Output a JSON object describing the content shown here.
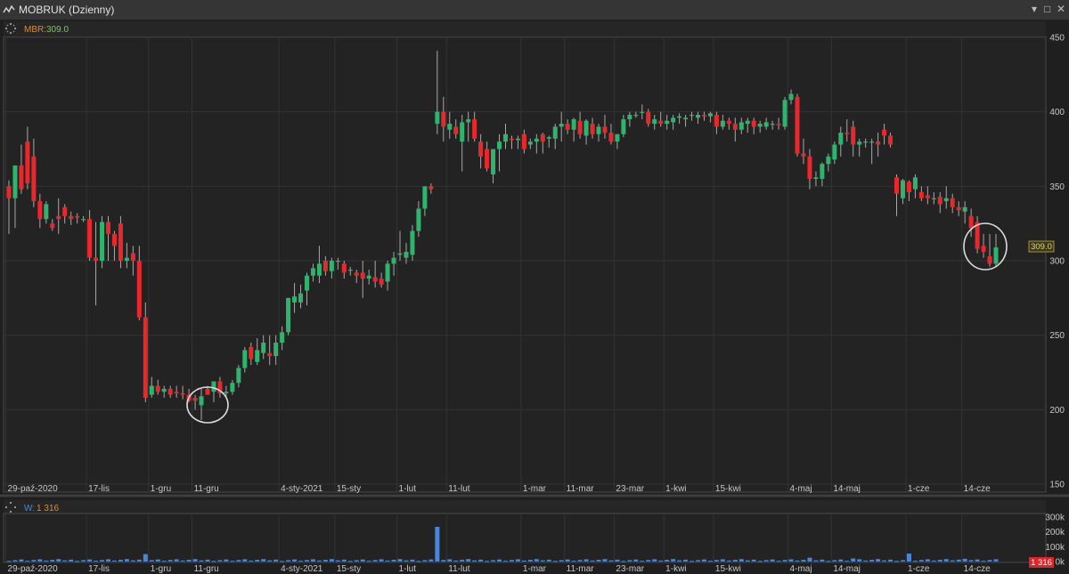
{
  "window": {
    "title": "MOBRUK (Dzienny)",
    "controls": [
      "▾",
      "□",
      "✕"
    ]
  },
  "price_panel": {
    "label": "MBR:",
    "value": "309.0",
    "last_price_badge": "309.0"
  },
  "volume_panel": {
    "label": "W:",
    "value": "1 316",
    "last_volume_badge": "1 316"
  },
  "colors": {
    "up": "#2fb46e",
    "down": "#e8282c",
    "volume": "#4a86d8",
    "label_orange": "#e08a2a",
    "value_green": "#7ec36a"
  },
  "chart_data": [
    {
      "type": "candlestick",
      "ylim": [
        150,
        450
      ],
      "y_ticks": [
        "450",
        "400",
        "350",
        "300",
        "250",
        "200",
        "150"
      ],
      "x_tick_labels": [
        "29-paź-2020",
        "17-lis",
        "1-gru",
        "11-gru",
        "4-sty-2021",
        "15-sty",
        "1-lut",
        "11-lut",
        "1-mar",
        "11-mar",
        "23-mar",
        "1-kwi",
        "15-kwi",
        "4-maj",
        "14-maj",
        "1-cze",
        "14-cze"
      ],
      "x_tick_index": [
        0,
        13,
        23,
        30,
        44,
        53,
        63,
        71,
        83,
        90,
        98,
        106,
        114,
        126,
        133,
        145,
        154
      ],
      "candles": [
        [
          350,
          354,
          318,
          342
        ],
        [
          342,
          362,
          322,
          364
        ],
        [
          364,
          378,
          345,
          348
        ],
        [
          380,
          390,
          348,
          352
        ],
        [
          370,
          382,
          336,
          340
        ],
        [
          340,
          345,
          322,
          328
        ],
        [
          328,
          340,
          325,
          338
        ],
        [
          325,
          328,
          320,
          322
        ],
        [
          330,
          342,
          318,
          328
        ],
        [
          336,
          338,
          325,
          330
        ],
        [
          330,
          333,
          324,
          328
        ],
        [
          330,
          332,
          325,
          329
        ],
        [
          328,
          330,
          326,
          328
        ],
        [
          328,
          334,
          300,
          302
        ],
        [
          302,
          326,
          270,
          300
        ],
        [
          300,
          330,
          295,
          326
        ],
        [
          326,
          330,
          300,
          318
        ],
        [
          318,
          320,
          300,
          310
        ],
        [
          325,
          330,
          295,
          300
        ],
        [
          300,
          312,
          295,
          302
        ],
        [
          305,
          310,
          290,
          300
        ],
        [
          300,
          310,
          260,
          262
        ],
        [
          262,
          272,
          205,
          208
        ],
        [
          210,
          222,
          208,
          216
        ],
        [
          216,
          220,
          210,
          212
        ],
        [
          212,
          216,
          208,
          214
        ],
        [
          214,
          216,
          208,
          210
        ],
        [
          212,
          216,
          208,
          211
        ],
        [
          211,
          216,
          207,
          210
        ],
        [
          210,
          214,
          205,
          206
        ],
        [
          208,
          210,
          200,
          206
        ],
        [
          203,
          214,
          193,
          209
        ],
        [
          214,
          216,
          210,
          210
        ],
        [
          212,
          218,
          205,
          219
        ],
        [
          219,
          222,
          208,
          211
        ],
        [
          211,
          216,
          209,
          212
        ],
        [
          212,
          220,
          210,
          218
        ],
        [
          218,
          230,
          215,
          228
        ],
        [
          228,
          242,
          225,
          240
        ],
        [
          242,
          245,
          230,
          234
        ],
        [
          232,
          248,
          230,
          240
        ],
        [
          238,
          250,
          234,
          245
        ],
        [
          238,
          250,
          230,
          236
        ],
        [
          236,
          250,
          230,
          245
        ],
        [
          245,
          256,
          240,
          252
        ],
        [
          252,
          275,
          250,
          275
        ],
        [
          272,
          285,
          265,
          276
        ],
        [
          272,
          284,
          268,
          278
        ],
        [
          280,
          292,
          270,
          290
        ],
        [
          290,
          298,
          286,
          295
        ],
        [
          290,
          310,
          285,
          298
        ],
        [
          300,
          303,
          290,
          293
        ],
        [
          293,
          302,
          288,
          300
        ],
        [
          300,
          302,
          294,
          300
        ],
        [
          298,
          300,
          288,
          292
        ],
        [
          294,
          296,
          290,
          294
        ],
        [
          292,
          294,
          285,
          290
        ],
        [
          292,
          300,
          275,
          288
        ],
        [
          288,
          294,
          284,
          290
        ],
        [
          289,
          300,
          282,
          286
        ],
        [
          288,
          292,
          282,
          284
        ],
        [
          286,
          300,
          280,
          298
        ],
        [
          298,
          306,
          290,
          302
        ],
        [
          304,
          320,
          300,
          305
        ],
        [
          302,
          312,
          298,
          306
        ],
        [
          304,
          324,
          300,
          320
        ],
        [
          320,
          340,
          316,
          335
        ],
        [
          335,
          350,
          330,
          350
        ],
        [
          350,
          352,
          345,
          348
        ],
        [
          392,
          441,
          385,
          400
        ],
        [
          400,
          410,
          380,
          390
        ],
        [
          388,
          400,
          382,
          392
        ],
        [
          390,
          395,
          382,
          385
        ],
        [
          380,
          398,
          360,
          393
        ],
        [
          393,
          400,
          380,
          395
        ],
        [
          395,
          400,
          380,
          382
        ],
        [
          380,
          385,
          362,
          370
        ],
        [
          375,
          380,
          360,
          362
        ],
        [
          358,
          375,
          352,
          375
        ],
        [
          375,
          385,
          360,
          380
        ],
        [
          380,
          392,
          375,
          385
        ],
        [
          382,
          384,
          375,
          381
        ],
        [
          381,
          384,
          375,
          382
        ],
        [
          385,
          388,
          372,
          375
        ],
        [
          378,
          382,
          375,
          380
        ],
        [
          380,
          385,
          372,
          382
        ],
        [
          385,
          386,
          372,
          380
        ],
        [
          382,
          384,
          376,
          383
        ],
        [
          382,
          392,
          375,
          390
        ],
        [
          390,
          400,
          380,
          392
        ],
        [
          392,
          395,
          385,
          388
        ],
        [
          388,
          396,
          380,
          395
        ],
        [
          394,
          400,
          382,
          385
        ],
        [
          384,
          395,
          378,
          394
        ],
        [
          392,
          396,
          382,
          385
        ],
        [
          385,
          392,
          380,
          390
        ],
        [
          390,
          398,
          382,
          386
        ],
        [
          386,
          392,
          378,
          380
        ],
        [
          380,
          385,
          375,
          385
        ],
        [
          385,
          398,
          383,
          395
        ],
        [
          395,
          400,
          390,
          398
        ],
        [
          398,
          400,
          396,
          398
        ],
        [
          400,
          405,
          395,
          400
        ],
        [
          400,
          402,
          390,
          392
        ],
        [
          392,
          398,
          388,
          395
        ],
        [
          394,
          400,
          390,
          392
        ],
        [
          392,
          398,
          388,
          394
        ],
        [
          393,
          398,
          388,
          396
        ],
        [
          396,
          399,
          392,
          397
        ],
        [
          395,
          398,
          390,
          396
        ],
        [
          398,
          400,
          394,
          398
        ],
        [
          396,
          400,
          392,
          398
        ],
        [
          398,
          400,
          394,
          397
        ],
        [
          397,
          400,
          393,
          399
        ],
        [
          398,
          400,
          385,
          390
        ],
        [
          390,
          398,
          388,
          394
        ],
        [
          394,
          396,
          388,
          392
        ],
        [
          392,
          396,
          380,
          388
        ],
        [
          388,
          396,
          385,
          393
        ],
        [
          392,
          396,
          386,
          394
        ],
        [
          394,
          396,
          385,
          390
        ],
        [
          390,
          394,
          386,
          392
        ],
        [
          390,
          396,
          388,
          393
        ],
        [
          392,
          394,
          388,
          392
        ],
        [
          392,
          396,
          388,
          391
        ],
        [
          390,
          410,
          388,
          408
        ],
        [
          408,
          415,
          405,
          412
        ],
        [
          410,
          412,
          370,
          372
        ],
        [
          372,
          382,
          365,
          370
        ],
        [
          370,
          375,
          348,
          355
        ],
        [
          355,
          360,
          350,
          356
        ],
        [
          355,
          366,
          350,
          365
        ],
        [
          365,
          372,
          360,
          370
        ],
        [
          368,
          380,
          365,
          378
        ],
        [
          378,
          390,
          370,
          386
        ],
        [
          386,
          395,
          380,
          385
        ],
        [
          390,
          394,
          370,
          378
        ],
        [
          378,
          382,
          370,
          380
        ],
        [
          380,
          382,
          376,
          380
        ],
        [
          380,
          382,
          365,
          380
        ],
        [
          380,
          386,
          370,
          378
        ],
        [
          388,
          392,
          378,
          384
        ],
        [
          384,
          386,
          376,
          378
        ],
        [
          356,
          358,
          330,
          345
        ],
        [
          342,
          355,
          338,
          354
        ],
        [
          353,
          354,
          340,
          346
        ],
        [
          348,
          358,
          342,
          356
        ],
        [
          346,
          350,
          340,
          342
        ],
        [
          344,
          350,
          338,
          342
        ],
        [
          342,
          346,
          338,
          342
        ],
        [
          343,
          346,
          332,
          338
        ],
        [
          340,
          350,
          335,
          342
        ],
        [
          342,
          345,
          332,
          336
        ],
        [
          336,
          340,
          330,
          334
        ],
        [
          333,
          340,
          325,
          336
        ],
        [
          330,
          335,
          316,
          322
        ],
        [
          326,
          330,
          305,
          308
        ],
        [
          310,
          318,
          302,
          306
        ],
        [
          303,
          318,
          296,
          298
        ],
        [
          298,
          318,
          296,
          309
        ]
      ]
    },
    {
      "type": "bar",
      "ylim": [
        0,
        300000
      ],
      "y_ticks": [
        "300k",
        "200k",
        "100k",
        "0k"
      ],
      "spikes": [
        {
          "index": 22,
          "value": 48000
        },
        {
          "index": 69,
          "value": 225000
        },
        {
          "index": 129,
          "value": 25000
        },
        {
          "index": 136,
          "value": 20000
        },
        {
          "index": 145,
          "value": 52000
        },
        {
          "index": 154,
          "value": 18000
        }
      ]
    }
  ]
}
